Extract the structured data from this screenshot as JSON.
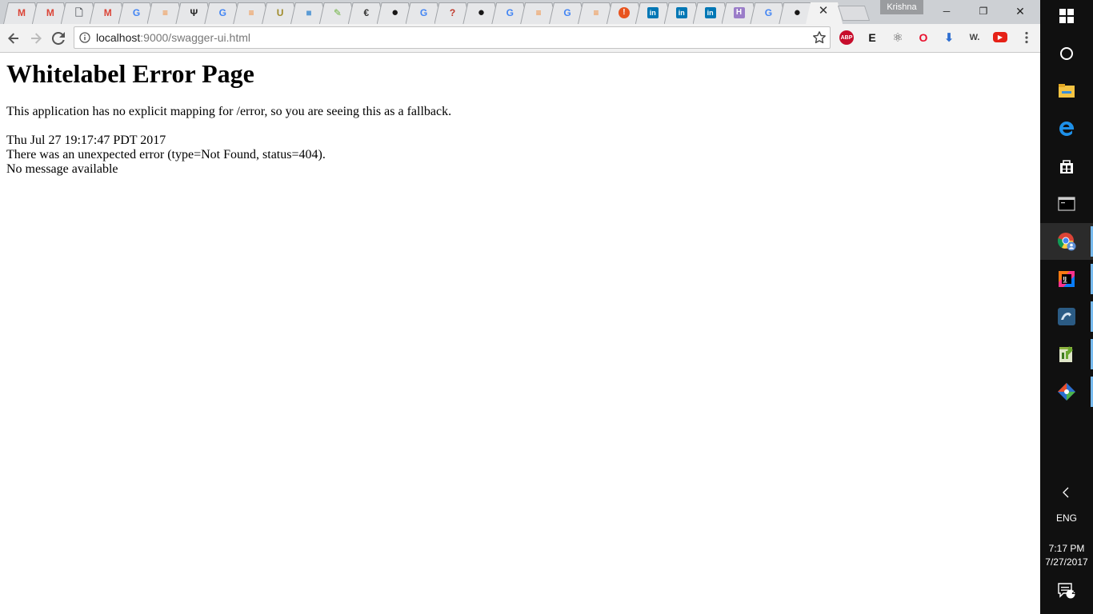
{
  "browser": {
    "profile_name": "Krishna",
    "tabs": [
      {
        "icon": "gmail-icon",
        "glyph": "M",
        "color": "#db4437"
      },
      {
        "icon": "gmail-icon",
        "glyph": "M",
        "color": "#db4437"
      },
      {
        "icon": "document-icon",
        "glyph": "🗋",
        "color": "#5f6368"
      },
      {
        "icon": "gmail-icon",
        "glyph": "M",
        "color": "#db4437"
      },
      {
        "icon": "google-icon",
        "glyph": "G",
        "color": "#4285f4"
      },
      {
        "icon": "stackoverflow-icon",
        "glyph": "≡",
        "color": "#f48024"
      },
      {
        "icon": "producthunt-icon",
        "glyph": "Ψ",
        "color": "#222222"
      },
      {
        "icon": "google-icon",
        "glyph": "G",
        "color": "#4285f4"
      },
      {
        "icon": "stackoverflow-icon",
        "glyph": "≡",
        "color": "#f48024"
      },
      {
        "icon": "udemy-icon",
        "glyph": "U",
        "color": "#a08b2a"
      },
      {
        "icon": "blue-square-icon",
        "glyph": "■",
        "color": "#5b9bd5"
      },
      {
        "icon": "spring-icon",
        "glyph": "✎",
        "color": "#6db33f"
      },
      {
        "icon": "dotcom-icon",
        "glyph": "€",
        "color": "#333333"
      },
      {
        "icon": "github-icon",
        "glyph": "●",
        "color": "#181717"
      },
      {
        "icon": "google-icon",
        "glyph": "G",
        "color": "#4285f4"
      },
      {
        "icon": "question-icon",
        "glyph": "?",
        "color": "#c0392b"
      },
      {
        "icon": "github-icon",
        "glyph": "●",
        "color": "#181717"
      },
      {
        "icon": "google-icon",
        "glyph": "G",
        "color": "#4285f4"
      },
      {
        "icon": "stackoverflow-icon",
        "glyph": "≡",
        "color": "#f48024"
      },
      {
        "icon": "google-icon",
        "glyph": "G",
        "color": "#4285f4"
      },
      {
        "icon": "stackoverflow-icon",
        "glyph": "≡",
        "color": "#f48024"
      },
      {
        "icon": "alert-icon",
        "glyph": "!",
        "color": "#e8541f"
      },
      {
        "icon": "linkedin-icon",
        "glyph": "in",
        "color": "#0077b5"
      },
      {
        "icon": "linkedin-icon",
        "glyph": "in",
        "color": "#0077b5"
      },
      {
        "icon": "linkedin-icon",
        "glyph": "in",
        "color": "#0077b5"
      },
      {
        "icon": "heroku-icon",
        "glyph": "H",
        "color": "#9b7dc9"
      },
      {
        "icon": "google-icon",
        "glyph": "G",
        "color": "#4285f4"
      },
      {
        "icon": "github-icon",
        "glyph": "●",
        "color": "#181717"
      }
    ],
    "active_tab": {
      "close_glyph": "✕"
    },
    "window_controls": {
      "minimize": "─",
      "restore": "❐",
      "close": "✕"
    },
    "address_bar": {
      "url_host": "localhost",
      "url_rest": ":9000/swagger-ui.html"
    },
    "extensions": [
      {
        "icon": "adblock-plus-icon",
        "glyph": "ABP",
        "color": "#c70d2c"
      },
      {
        "icon": "evernote-icon",
        "glyph": "E",
        "color": "#111111"
      },
      {
        "icon": "react-devtools-icon",
        "glyph": "⚛",
        "color": "#555555"
      },
      {
        "icon": "opera-icon",
        "glyph": "O",
        "color": "#e8102d"
      },
      {
        "icon": "download-icon",
        "glyph": "⬇",
        "color": "#2f6fd1"
      },
      {
        "icon": "wappalyzer-icon",
        "glyph": "W.",
        "color": "#444444"
      },
      {
        "icon": "youtube-icon",
        "glyph": "▶",
        "color": "#e62117"
      }
    ]
  },
  "page": {
    "heading": "Whitelabel Error Page",
    "description": "This application has no explicit mapping for /error, so you are seeing this as a fallback.",
    "timestamp": "Thu Jul 27 19:17:47 PDT 2017",
    "error_text": "There was an unexpected error (type=Not Found, status=404).",
    "message": "No message available"
  },
  "taskbar": {
    "items": [
      {
        "icon": "windows-start-icon"
      },
      {
        "icon": "cortana-icon"
      },
      {
        "icon": "file-explorer-icon"
      },
      {
        "icon": "edge-icon"
      },
      {
        "icon": "store-icon"
      },
      {
        "icon": "terminal-icon"
      },
      {
        "icon": "chrome-icon",
        "running": true,
        "active": true
      },
      {
        "icon": "intellij-icon",
        "running": true
      },
      {
        "icon": "mysql-workbench-icon",
        "running": true
      },
      {
        "icon": "notepadpp-icon",
        "running": true
      },
      {
        "icon": "sourcetree-icon",
        "running": true
      }
    ],
    "tray": {
      "language": "ENG",
      "time": "7:17 PM",
      "date": "7/27/2017",
      "notification_count": "2"
    }
  }
}
